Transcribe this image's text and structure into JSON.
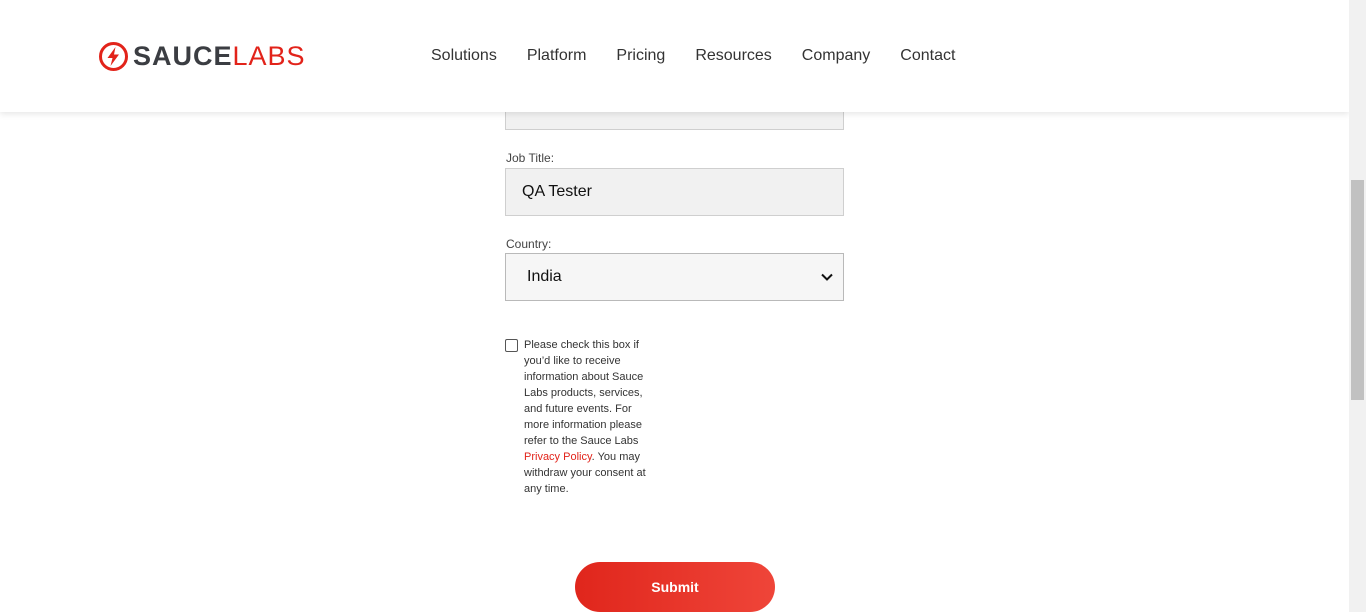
{
  "header": {
    "logo": {
      "word1": "SAUCE",
      "word2": "LABS"
    },
    "nav": [
      "Solutions",
      "Platform",
      "Pricing",
      "Resources",
      "Company",
      "Contact"
    ]
  },
  "form": {
    "job_title_label": "Job Title:",
    "job_title_value": "QA Tester",
    "country_label": "Country:",
    "country_value": "India",
    "consent_text": "Please check this box if you’d like to receive information about Sauce Labs products, services, and future events. For more information please refer to the Sauce Labs",
    "privacy_link": "Privacy Policy",
    "consent_tail": ". You may withdraw your consent at any time.",
    "submit_label": "Submit"
  },
  "colors": {
    "brand_red": "#e2231a",
    "logo_gray": "#3b3d42"
  }
}
